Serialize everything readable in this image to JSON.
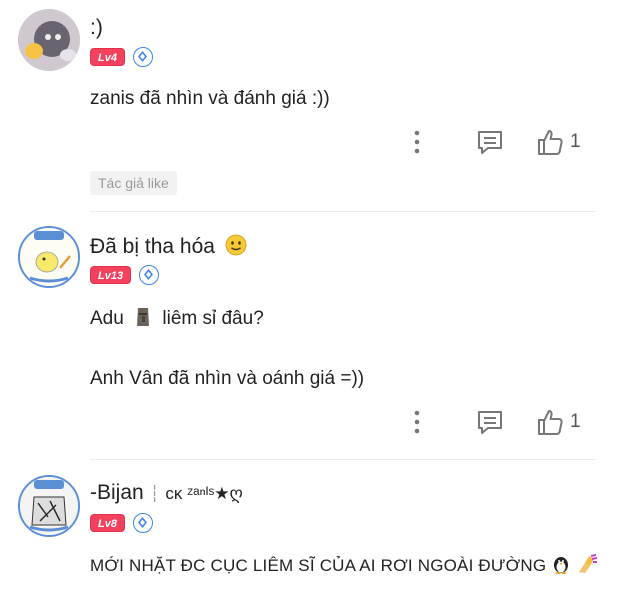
{
  "comments": [
    {
      "name": ":)",
      "level": "Lv4",
      "text_lines": [
        "zanis đã nhìn và đánh giá :))"
      ],
      "likes": "1",
      "author_like": "Tác giả like"
    },
    {
      "name": "Đã bị tha hóa",
      "level": "Lv13",
      "text_lines": [
        "Adu",
        "liêm sỉ đâu?",
        "Anh Vân đã nhìn và oánh giá =))"
      ],
      "likes": "1"
    },
    {
      "name": "-Bijan",
      "name_suffix": "ᴄᴋ ᶻᵃⁿᴵˢ★ღ",
      "level": "Lv8",
      "text_lines": [
        "MỚI NHẶT ĐC CỤC LIÊM SĨ CỦA AI RƠI NGOÀI ĐƯỜNG"
      ]
    }
  ],
  "icons": {
    "more": "more-vertical-icon",
    "reply": "comment-icon",
    "like": "thumbs-up-icon",
    "verified": "shield-icon",
    "emoji": "smiley-emoji"
  },
  "colors": {
    "level_badge": "#f4425e",
    "shield": "#3f86e8"
  }
}
